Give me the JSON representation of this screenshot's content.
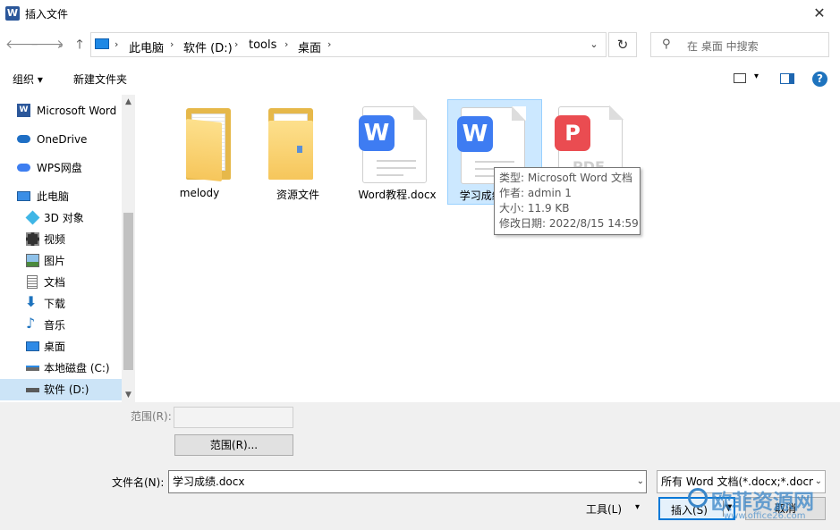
{
  "window": {
    "title": "插入文件",
    "app_icon": "W"
  },
  "nav": {
    "back": "🡐",
    "forward": "🡒",
    "recent": "⌄",
    "up": "🡑",
    "breadcrumb": [
      "此电脑",
      "软件 (D:)",
      "tools",
      "桌面"
    ],
    "search_placeholder": "在 桌面 中搜索"
  },
  "toolbar": {
    "organize": "组织 ▾",
    "new_folder": "新建文件夹",
    "help": "?"
  },
  "sidebar": {
    "items": [
      {
        "label": "Microsoft Word",
        "icon": "word-icon"
      },
      {
        "label": "OneDrive",
        "icon": "cloud-icon"
      },
      {
        "label": "WPS网盘",
        "icon": "wps-cloud-icon"
      },
      {
        "label": "此电脑",
        "icon": "computer-icon"
      },
      {
        "label": "3D 对象",
        "icon": "3d-objects-icon"
      },
      {
        "label": "视频",
        "icon": "video-icon"
      },
      {
        "label": "图片",
        "icon": "pictures-icon"
      },
      {
        "label": "文档",
        "icon": "documents-icon"
      },
      {
        "label": "下载",
        "icon": "download-icon"
      },
      {
        "label": "音乐",
        "icon": "music-icon"
      },
      {
        "label": "桌面",
        "icon": "desktop-icon"
      },
      {
        "label": "本地磁盘 (C:)",
        "icon": "drive-icon"
      },
      {
        "label": "软件 (D:)",
        "icon": "drive-icon"
      }
    ],
    "selected_index": 12
  },
  "files": [
    {
      "name": "melody",
      "type": "folder",
      "icon": "folder-icon"
    },
    {
      "name": "资源文件",
      "type": "folder",
      "icon": "folder-icon"
    },
    {
      "name": "Word教程.docx",
      "type": "docx",
      "icon": "wps-writer-icon",
      "badge": "W"
    },
    {
      "name": "学习成绩.docx",
      "type": "docx",
      "icon": "wps-writer-icon",
      "badge": "W",
      "selected": true
    },
    {
      "name": "",
      "type": "pdf",
      "icon": "pdf-icon",
      "badge": "P",
      "label_partial": "PDF"
    }
  ],
  "tooltip": {
    "type": "类型: Microsoft Word 文档",
    "author": "作者: admin 1",
    "size": "大小: 11.9 KB",
    "modified": "修改日期: 2022/8/15 14:59"
  },
  "bottom": {
    "range_label": "范围(R):",
    "range_button": "范围(R)...",
    "filename_label": "文件名(N):",
    "filename_value": "学习成绩.docx",
    "filetype_value": "所有 Word 文档(*.docx;*.docm",
    "tools_label": "工具(L)",
    "insert_label": "插入(S)",
    "cancel_label": "取消"
  },
  "watermark": {
    "text": "欧菲资源网",
    "url": "www.office26.com"
  },
  "colors": {
    "accent": "#0078d7",
    "selected_bg": "#cce8ff",
    "wps_blue": "#3e7cf2",
    "pdf_red": "#ea4c51",
    "folder": "#f6c65b"
  }
}
